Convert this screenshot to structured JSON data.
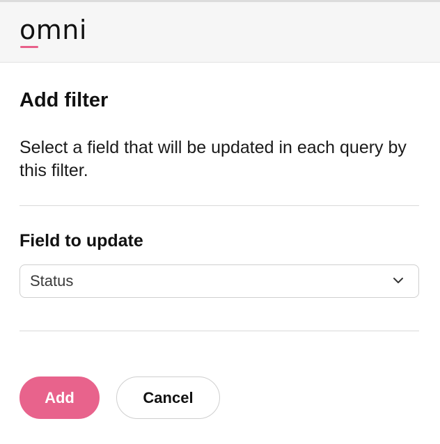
{
  "app": {
    "logo_text": "omni",
    "brand_color": "#e8638c"
  },
  "dialog": {
    "title": "Add filter",
    "description": "Select a field that will be updated in each query by this filter.",
    "field_label": "Field to update",
    "field_select": {
      "selected_value": "Status",
      "icon": "chevron-down-icon"
    },
    "buttons": {
      "add_label": "Add",
      "cancel_label": "Cancel"
    }
  }
}
